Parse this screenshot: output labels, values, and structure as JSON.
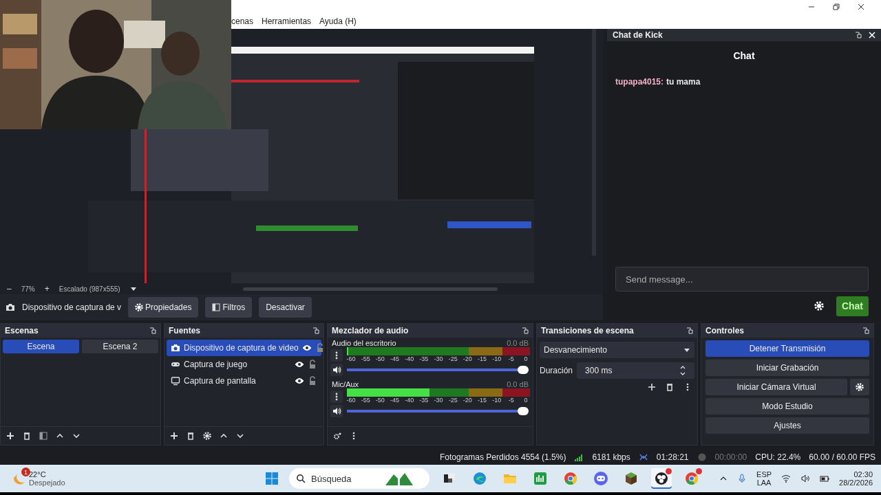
{
  "menu": [
    "cenas",
    "Herramientas",
    "Ayuda (H)"
  ],
  "preview": {
    "kind": "picture",
    "zoom_out": "–",
    "zoom": "77%",
    "zoom_in": "+",
    "scaling": "Escalado (987x555)"
  },
  "source_toolbar": {
    "source": "Dispositivo de captura de v",
    "buttons": [
      {
        "label": "Propiedades",
        "kind": "gear"
      },
      {
        "label": "Filtros",
        "kind": "filter"
      },
      {
        "label": "Desactivar",
        "kind": "plain"
      }
    ]
  },
  "chat": {
    "title": "Chat de Kick",
    "heading": "Chat",
    "messages": [
      {
        "user": "tupapa4015:",
        "color": "#f5b2c4",
        "text": "tu mama"
      }
    ],
    "placeholder": "Send message...",
    "send": "Chat"
  },
  "scenes": {
    "title": "Escenas",
    "items": [
      {
        "name": "Escena",
        "selected": true
      },
      {
        "name": "Escena 2",
        "selected": false
      }
    ]
  },
  "sources": {
    "title": "Fuentes",
    "items": [
      {
        "name": "Dispositivo de captura de video",
        "kind": "camera",
        "selected": true,
        "visible": true,
        "locked": false
      },
      {
        "name": "Captura de juego",
        "kind": "gamepad",
        "selected": false,
        "visible": true,
        "locked": false
      },
      {
        "name": "Captura de pantalla",
        "kind": "monitor",
        "selected": false,
        "visible": true,
        "locked": false
      }
    ]
  },
  "mixer": {
    "title": "Mezclador de audio",
    "channels": [
      {
        "name": "Audio del escritorio",
        "reading": "0.0 dB",
        "meter": {
          "level": 0
        },
        "volume": {
          "level": 1
        },
        "muted": false,
        "scale": [
          "-60",
          "-55",
          "-50",
          "-45",
          "-40",
          "-35",
          "-30",
          "-25",
          "-20",
          "-15",
          "-10",
          "-5",
          "0"
        ]
      },
      {
        "name": "Mic/Aux",
        "reading": "0.0 dB",
        "meter": {
          "level": 0.45
        },
        "volume": {
          "level": 1
        },
        "muted": false,
        "scale": [
          "-60",
          "-55",
          "-50",
          "-45",
          "-40",
          "-35",
          "-30",
          "-25",
          "-20",
          "-15",
          "-10",
          "-5",
          "0"
        ]
      }
    ]
  },
  "transitions": {
    "title": "Transiciones de escena",
    "type": "Desvanecimiento",
    "duration_label": "Duración",
    "duration": "300 ms"
  },
  "controls": {
    "title": "Controles",
    "buttons": [
      {
        "label": "Detener Transmisión",
        "active": true,
        "settings": false
      },
      {
        "label": "Iniciar Grabación",
        "active": false,
        "settings": false
      },
      {
        "label": "Iniciar Cámara Virtual",
        "active": false,
        "settings": true
      },
      {
        "label": "Modo Estudio",
        "active": false,
        "settings": false
      },
      {
        "label": "Ajustes",
        "active": false,
        "settings": false
      }
    ]
  },
  "status_bar": {
    "dropped": "Fotogramas Perdidos 4554 (1.5%)",
    "bitrate": "6181 kbps",
    "stream_time": "01:28:21",
    "record_time": "00:00:00",
    "recording": false,
    "cpu": "CPU: 22.4%",
    "fps": "60.00 / 60.00 FPS"
  },
  "taskbar": {
    "weather": {
      "temp": "22°C",
      "sky": "Despejado",
      "badge": "1"
    },
    "search": {
      "placeholder": "Búsqueda"
    },
    "apps": [
      {
        "kind": "taskview",
        "active": false,
        "badge": false
      },
      {
        "kind": "swirl",
        "active": false,
        "badge": false
      },
      {
        "kind": "folder",
        "active": false,
        "badge": false
      },
      {
        "kind": "chart",
        "active": false,
        "badge": false
      },
      {
        "kind": "browser",
        "active": false,
        "badge": false
      },
      {
        "kind": "chat",
        "active": false,
        "badge": false
      },
      {
        "kind": "cube",
        "active": false,
        "badge": false
      },
      {
        "kind": "recorder",
        "active": true,
        "badge": true
      },
      {
        "kind": "browser",
        "active": false,
        "badge": true
      }
    ],
    "lang": "ESP",
    "region": "LAA",
    "time": "02:30",
    "date": "28/2/2026"
  }
}
